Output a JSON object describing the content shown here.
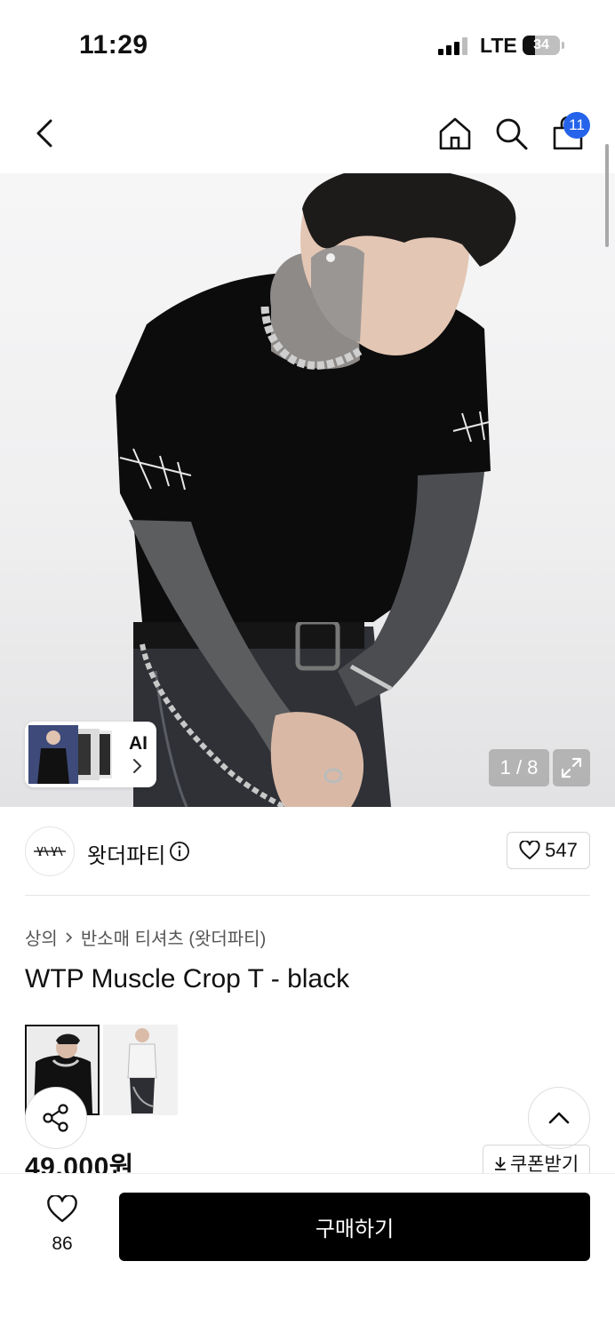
{
  "status_bar": {
    "time": "11:29",
    "network": "LTE",
    "battery": "34",
    "battery_level": 0.34
  },
  "header": {
    "back_icon": "chevron-left-icon",
    "home_icon": "home-icon",
    "search_icon": "search-icon",
    "cart_icon": "shopping-bag-icon",
    "cart_badge": "11",
    "badge_color": "#2563eb"
  },
  "gallery": {
    "ai_label": "AI",
    "counter": "1 / 8",
    "expand_icon": "expand-icon"
  },
  "brand": {
    "name": "왓더파티",
    "info_icon": "info-icon",
    "likes": "547"
  },
  "breadcrumb": {
    "category": "상의",
    "subcategory": "반소매 티셔츠 (왓더파티)"
  },
  "product": {
    "title": "WTP Muscle Crop T - black",
    "price": "49,000원",
    "coupon_label": "쿠폰받기"
  },
  "bottom": {
    "favorite_count": "86",
    "buy_label": "구매하기",
    "accent": "#000000"
  }
}
